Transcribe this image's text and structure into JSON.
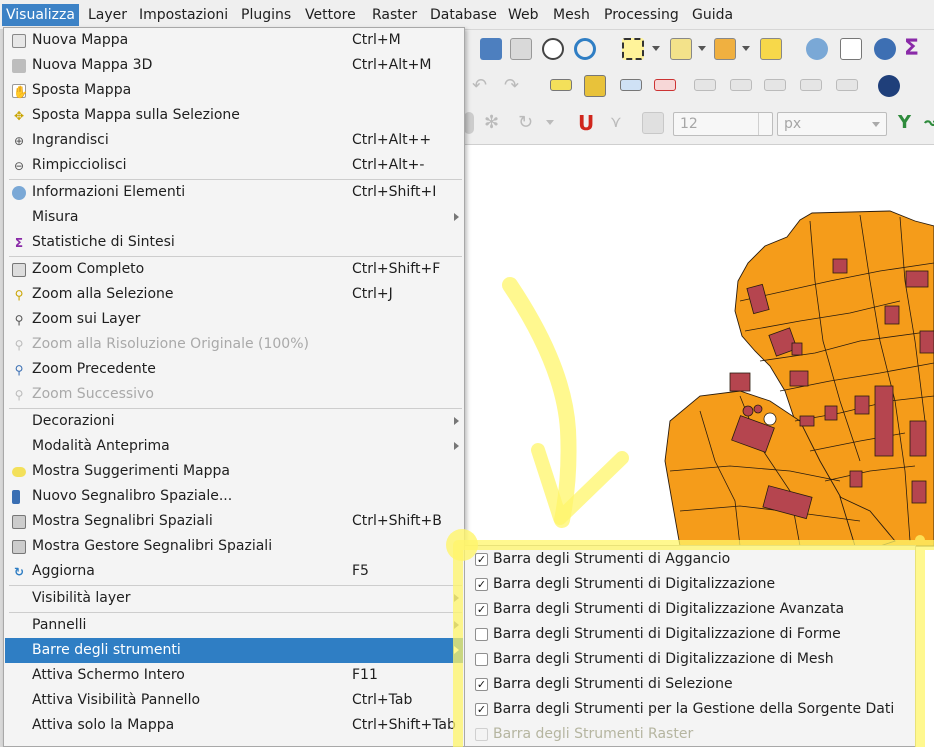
{
  "menubar": {
    "items": [
      {
        "label": "Visualizza",
        "active": true
      },
      {
        "label": "Layer"
      },
      {
        "label": "Impostazioni"
      },
      {
        "label": "Plugins"
      },
      {
        "label": "Vettore"
      },
      {
        "label": "Raster"
      },
      {
        "label": "Database"
      },
      {
        "label": "Web"
      },
      {
        "label": "Mesh"
      },
      {
        "label": "Processing"
      },
      {
        "label": "Guida"
      }
    ]
  },
  "toolbar": {
    "size_value": "12",
    "unit_value": "px"
  },
  "view_menu": {
    "items": [
      {
        "label": "Nuova Mappa",
        "shortcut": "Ctrl+M",
        "icon": "new-map-icon"
      },
      {
        "label": "Nuova Mappa 3D",
        "shortcut": "Ctrl+Alt+M",
        "icon": "new-3d-map-icon"
      },
      {
        "label": "Sposta Mappa",
        "shortcut": "",
        "icon": "pan-hand-icon"
      },
      {
        "label": "Sposta Mappa sulla Selezione",
        "shortcut": "",
        "icon": "pan-to-selection-icon"
      },
      {
        "label": "Ingrandisci",
        "shortcut": "Ctrl+Alt++",
        "icon": "zoom-in-icon"
      },
      {
        "label": "Rimpicciolisci",
        "shortcut": "Ctrl+Alt+-",
        "icon": "zoom-out-icon"
      },
      {
        "label": "Informazioni Elementi",
        "shortcut": "Ctrl+Shift+I",
        "icon": "identify-icon"
      },
      {
        "label": "Misura",
        "shortcut": "",
        "icon": ""
      },
      {
        "label": "Statistiche di Sintesi",
        "shortcut": "",
        "icon": "sigma-icon"
      },
      {
        "label": "Zoom Completo",
        "shortcut": "Ctrl+Shift+F",
        "icon": "zoom-full-icon"
      },
      {
        "label": "Zoom alla Selezione",
        "shortcut": "Ctrl+J",
        "icon": "zoom-selection-icon"
      },
      {
        "label": "Zoom sui Layer",
        "shortcut": "",
        "icon": "zoom-layer-icon"
      },
      {
        "label": "Zoom alla Risoluzione Originale (100%)",
        "shortcut": "",
        "icon": "zoom-actual-icon"
      },
      {
        "label": "Zoom Precedente",
        "shortcut": "",
        "icon": "zoom-last-icon"
      },
      {
        "label": "Zoom Successivo",
        "shortcut": "",
        "icon": "zoom-next-icon"
      },
      {
        "label": "Decorazioni",
        "shortcut": "",
        "icon": ""
      },
      {
        "label": "Modalità Anteprima",
        "shortcut": "",
        "icon": ""
      },
      {
        "label": "Mostra Suggerimenti Mappa",
        "shortcut": "",
        "icon": "map-tips-icon"
      },
      {
        "label": "Nuovo Segnalibro Spaziale...",
        "shortcut": "",
        "icon": "new-bookmark-icon"
      },
      {
        "label": "Mostra Segnalibri Spaziali",
        "shortcut": "Ctrl+Shift+B",
        "icon": "bookmarks-icon"
      },
      {
        "label": "Mostra Gestore Segnalibri Spaziali",
        "shortcut": "",
        "icon": "bookmark-manager-icon"
      },
      {
        "label": "Aggiorna",
        "shortcut": "F5",
        "icon": "refresh-icon"
      },
      {
        "label": "Visibilità layer",
        "shortcut": "",
        "icon": ""
      },
      {
        "label": "Pannelli",
        "shortcut": "",
        "icon": ""
      },
      {
        "label": "Barre degli strumenti",
        "shortcut": "",
        "icon": ""
      },
      {
        "label": "Attiva Schermo Intero",
        "shortcut": "F11",
        "icon": ""
      },
      {
        "label": "Attiva Visibilità Pannello",
        "shortcut": "Ctrl+Tab",
        "icon": ""
      },
      {
        "label": "Attiva solo la Mappa",
        "shortcut": "Ctrl+Shift+Tab",
        "icon": ""
      }
    ]
  },
  "toolbars_submenu": {
    "items": [
      {
        "label": "Barra degli Strumenti di Aggancio",
        "checked": true
      },
      {
        "label": "Barra degli Strumenti di Digitalizzazione",
        "checked": true
      },
      {
        "label": "Barra degli Strumenti di Digitalizzazione Avanzata",
        "checked": true
      },
      {
        "label": "Barra degli Strumenti di Digitalizzazione di Forme",
        "checked": false
      },
      {
        "label": "Barra degli Strumenti di Digitalizzazione di Mesh",
        "checked": false
      },
      {
        "label": "Barra degli Strumenti di Selezione",
        "checked": true
      },
      {
        "label": "Barra degli Strumenti per la Gestione della Sorgente Dati",
        "checked": true
      },
      {
        "label": "Barra degli Strumenti Raster",
        "checked": false
      }
    ]
  },
  "colors": {
    "parcel": "#f59c1a",
    "building": "#b5454f",
    "highlight": "#2f7ec4",
    "annotation": "#fff56a"
  }
}
